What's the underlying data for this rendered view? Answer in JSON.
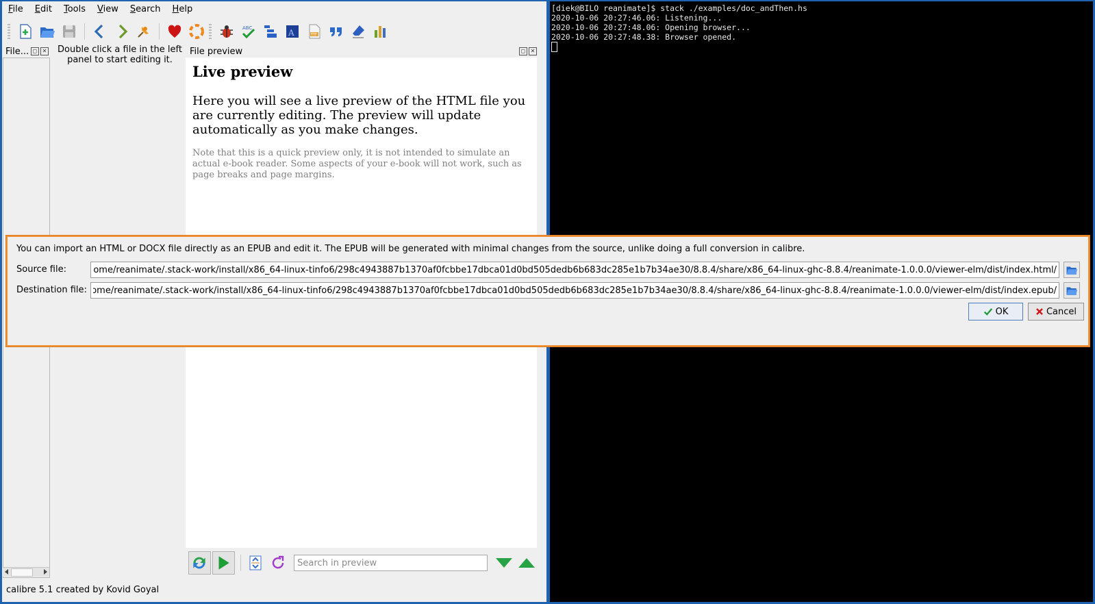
{
  "menu": {
    "items": [
      "File",
      "Edit",
      "Tools",
      "View",
      "Search",
      "Help"
    ]
  },
  "file_browser": {
    "title": "File..."
  },
  "editor": {
    "hint": "Double click a file in the left panel to start editing it."
  },
  "preview": {
    "title": "File preview",
    "heading": "Live preview",
    "paragraph": "Here you will see a live preview of the HTML file you are currently editing. The preview will update automatically as you make changes.",
    "note": "Note that this is a quick preview only, it is not intended to simulate an actual e-book reader. Some aspects of your e-book will not work, such as page breaks and page margins.",
    "search_placeholder": "Search in preview"
  },
  "status": {
    "text": "calibre 5.1 created by Kovid Goyal"
  },
  "terminal": {
    "lines": [
      "[diek@BILO reanimate]$ stack ./examples/doc_andThen.hs",
      "2020-10-06 20:27:46.06: Listening...",
      "2020-10-06 20:27:48.06: Opening browser...",
      "2020-10-06 20:27:48.38: Browser opened."
    ]
  },
  "dialog": {
    "message": "You can import an HTML or DOCX file directly as an EPUB and edit it. The EPUB will be generated with minimal changes from the source, unlike doing a full conversion in calibre.",
    "source_label": "Source file:",
    "source_value": "/home/reanimate/.stack-work/install/x86_64-linux-tinfo6/298c4943887b1370af0fcbbe17dbca01d0bd505dedb6b683dc285e1b7b34ae30/8.8.4/share/x86_64-linux-ghc-8.8.4/reanimate-1.0.0.0/viewer-elm/dist/index.html",
    "dest_label": "Destination file:",
    "dest_value": "/home/reanimate/.stack-work/install/x86_64-linux-tinfo6/298c4943887b1370af0fcbbe17dbca01d0bd505dedb6b683dc285e1b7b34ae30/8.8.4/share/x86_64-linux-ghc-8.8.4/reanimate-1.0.0.0/viewer-elm/dist/index.epub",
    "ok_label": "OK",
    "cancel_label": "Cancel"
  },
  "colors": {
    "desktop": "#1f62b0",
    "dialog_border": "#f0923a",
    "terminal_bg": "#000000"
  }
}
